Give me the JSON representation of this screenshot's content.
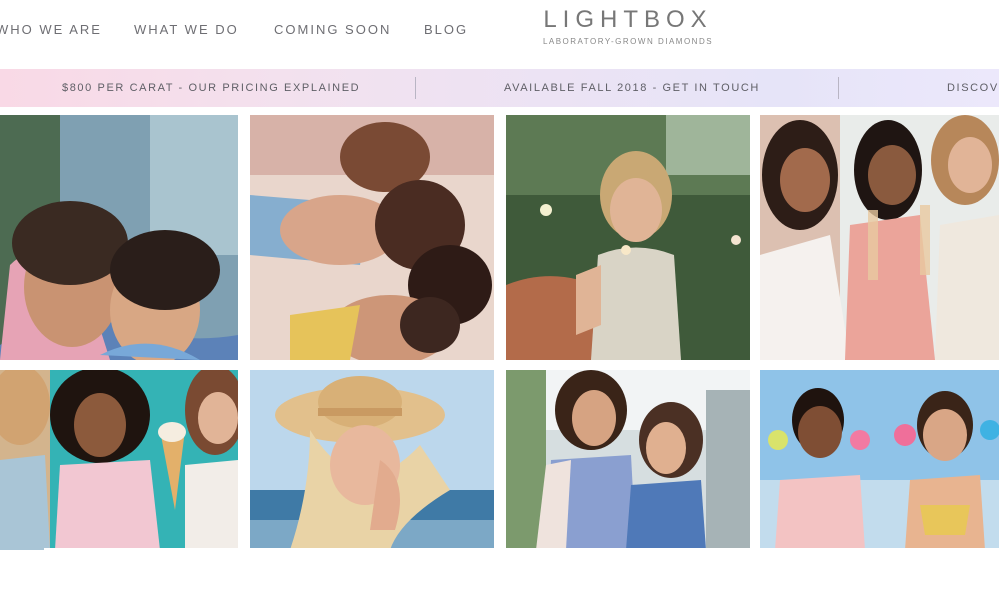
{
  "nav": {
    "items": [
      "WHO WE ARE",
      "WHAT WE DO",
      "COMING SOON",
      "BLOG"
    ]
  },
  "logo": {
    "wordmark": "LIGHTBOX",
    "tagline": "LABORATORY-GROWN DIAMONDS"
  },
  "banner": {
    "items": [
      "$800 PER CARAT - OUR PRICING EXPLAINED",
      "AVAILABLE FALL 2018 - GET IN TOUCH",
      "DISCOVE"
    ]
  },
  "gallery": {
    "photos": [
      "mother-daughter-hug-photo",
      "friends-lying-in-circle-photo",
      "woman-with-sparkler-photo",
      "friends-toasting-photo",
      "friends-with-ice-cream-photo",
      "woman-in-straw-hat-photo",
      "mother-daughter-walking-photo",
      "friends-with-pinwheels-photo"
    ]
  },
  "colors": {
    "banner_start": "#f9d9e6",
    "banner_end": "#ece8fb",
    "nav_text": "#6e6e73"
  }
}
